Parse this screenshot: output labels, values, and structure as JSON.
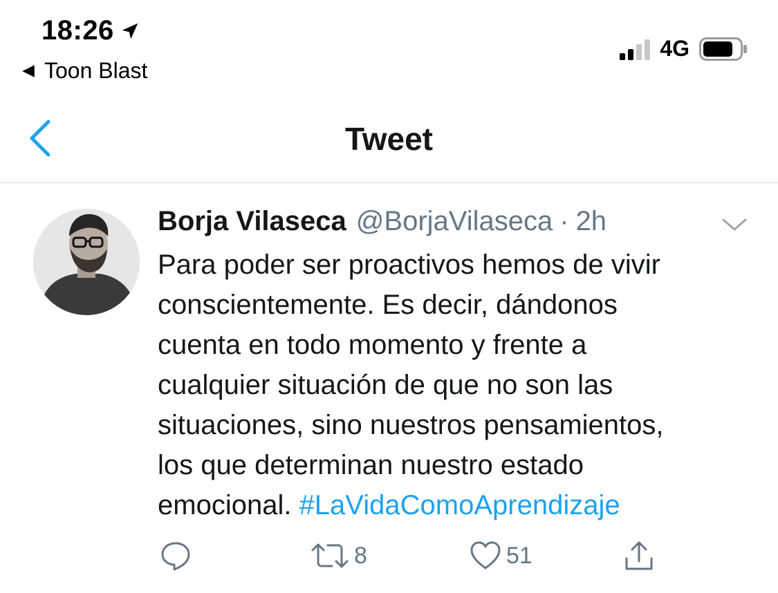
{
  "status_bar": {
    "time": "18:26",
    "back_app": "Toon Blast",
    "network": "4G",
    "icons": {
      "location": "location-arrow-icon",
      "back": "back-triangle-icon",
      "signal": "cellular-signal-icon",
      "battery": "battery-icon"
    }
  },
  "nav": {
    "title": "Tweet",
    "back_icon": "chevron-left-icon"
  },
  "tweet": {
    "author_name": "Borja Vilaseca",
    "handle": "@BorjaVilaseca",
    "separator": "·",
    "time": "2h",
    "text_lines": [
      "Para poder ser proactivos hemos de vivir",
      "conscientemente. Es decir, dándonos",
      "cuenta en todo momento y frente a",
      "cualquier situación de que no son las",
      "situaciones, sino nuestros pensamientos,",
      "los que determinan nuestro estado"
    ],
    "last_line_text": "emocional.",
    "hashtag": "#LaVidaComoAprendizaje"
  },
  "actions": {
    "reply_icon": "reply-bubble-icon",
    "retweet_icon": "retweet-icon",
    "retweet_count": "8",
    "like_icon": "heart-icon",
    "like_count": "51",
    "share_icon": "share-icon"
  },
  "colors": {
    "accent": "#1da1f2",
    "secondary_text": "#657786",
    "primary_text": "#14171a",
    "divider": "#d7dbdf"
  }
}
